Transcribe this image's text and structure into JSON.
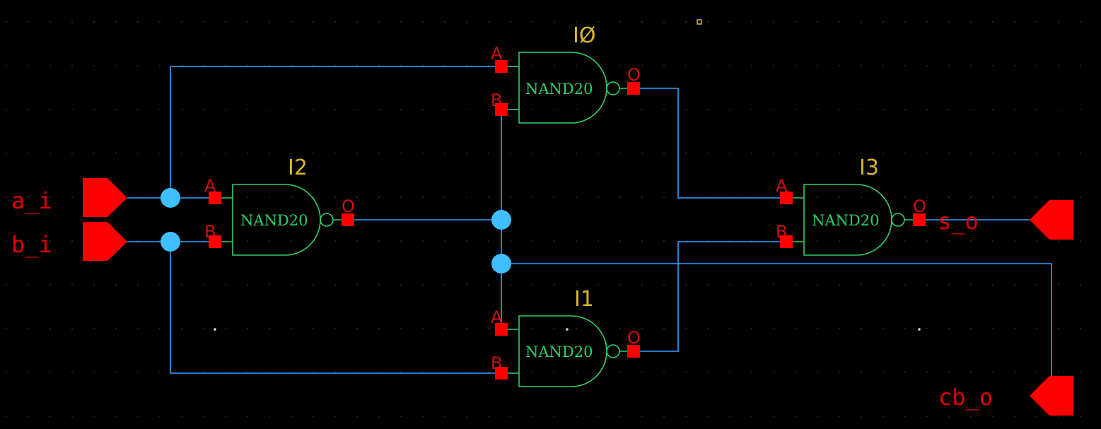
{
  "gates": [
    {
      "id": "I0",
      "instance": "IØ",
      "cell": "NAND20",
      "pin_a": "A",
      "pin_b": "B",
      "pin_out": "O"
    },
    {
      "id": "I1",
      "instance": "I1",
      "cell": "NAND20",
      "pin_a": "A",
      "pin_b": "B",
      "pin_out": "O"
    },
    {
      "id": "I2",
      "instance": "I2",
      "cell": "NAND20",
      "pin_a": "A",
      "pin_b": "B",
      "pin_out": "O"
    },
    {
      "id": "I3",
      "instance": "I3",
      "cell": "NAND20",
      "pin_a": "A",
      "pin_b": "B",
      "pin_out": "O"
    }
  ],
  "ports": {
    "a_i": "a_i",
    "b_i": "b_i",
    "s_o": "s_o",
    "cb_o": "cb_o"
  },
  "colors": {
    "background": "#000000",
    "wire": "#33a3ff",
    "junction": "#3fbfff",
    "pin": "#ff0000",
    "gate": "#2ccf6a",
    "instance_label": "#d8b62a",
    "port": "#ff0000"
  }
}
